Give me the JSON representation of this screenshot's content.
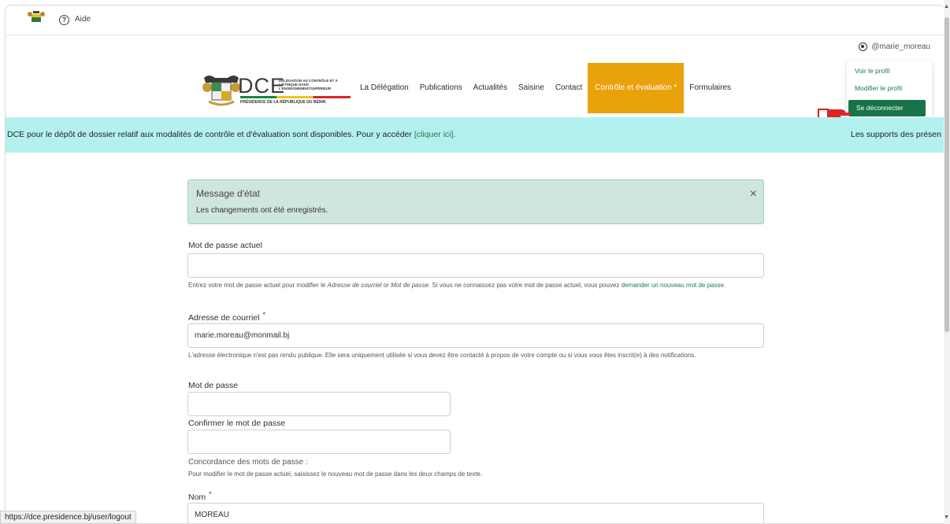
{
  "topbar": {
    "help_label": "Aide"
  },
  "user": {
    "username": "@marie_moreau",
    "menu": {
      "view_profile": "Voir le profil",
      "edit_profile": "Modifier le profil",
      "logout": "Se déconnecter"
    }
  },
  "brand": {
    "name": "DCE",
    "subtitle": "DÉLÉGATION AU CONTRÔLE ET À L'ÉTHIQUE DANS L'ENSEIGNEMENTSUPÉRIEUR",
    "presidency": "PRÉSIDENCE DE LA RÉPUBLIQUE DU BÉNIN"
  },
  "nav": {
    "items": [
      "La Délégation",
      "Publications",
      "Actualités",
      "Saisine",
      "Contact",
      "Contrôle et évaluation *",
      "Formulaires"
    ],
    "active_index": 5
  },
  "ticker": {
    "text": "DCE pour le dépôt de dossier relatif aux modalités de contrôle et d'évaluation sont disponibles. Pour y accéder ",
    "link": "[cliquer ici].",
    "text2": "Les supports des présen"
  },
  "status": {
    "title": "Message d'état",
    "message": "Les changements ont été enregistrés.",
    "close": "×"
  },
  "form": {
    "current_password": {
      "label": "Mot de passe actuel",
      "value": "",
      "help_pre": "Entrez votre mot de passe actuel pour modifier le ",
      "help_em1": "Adresse de courriel",
      "help_mid": " or ",
      "help_em2": "Mot de passe",
      "help_post": ". Si vous ne connaissez pas votre mot de passe actuel, vous pouvez ",
      "help_link": "demander un nouveau mot de passe",
      "help_end": "."
    },
    "email": {
      "label": "Adresse de courriel",
      "required": "*",
      "value": "marie.moreau@monmail.bj",
      "help": "L'adresse électronique n'est pas rendu publique. Elle sera uniquement utilisée si vous devez être contacté à propos de votre compte ou si vous vous êtes inscrit(e) à des notifications."
    },
    "password": {
      "label": "Mot de passe",
      "value": ""
    },
    "confirm_password": {
      "label": "Confirmer le mot de passe",
      "value": ""
    },
    "password_match": "Concordance des mots de passe :",
    "password_help": "Pour modifier le mot de passe actuel, saisissez le nouveau mot de passe dans les deux champs de texte.",
    "nom": {
      "label": "Nom",
      "required": "*",
      "value": "MOREAU"
    }
  },
  "status_url": "https://dce.presidence.bj/user/logout",
  "colors": {
    "accent_green": "#18734a",
    "active_nav": "#e9a20c",
    "ticker_bg": "#b3f1ef",
    "status_bg": "#cfe6de"
  }
}
